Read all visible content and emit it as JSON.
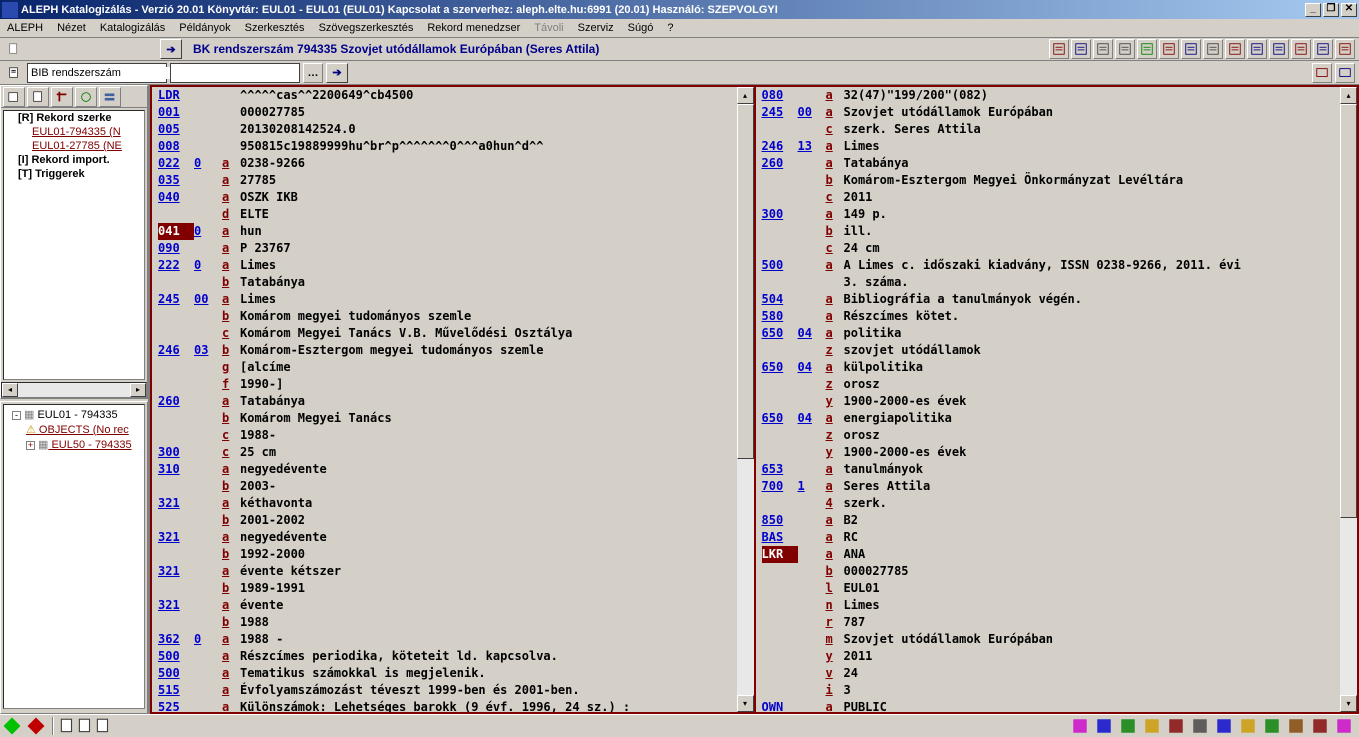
{
  "title": "ALEPH Katalogizálás - Verzió 20.01  Könyvtár: EUL01 - EUL01 (EUL01)  Kapcsolat a szerverhez:  aleph.elte.hu:6991 (20.01)  Használó:  SZEPVOLGYI",
  "menu": [
    "ALEPH",
    "Nézet",
    "Katalogizálás",
    "Példányok",
    "Szerkesztés",
    "Szövegszerkesztés",
    "Rekord menedzser",
    "Távoli",
    "Szerviz",
    "Súgó",
    "?"
  ],
  "menu_disabled": [
    7
  ],
  "record_label": "BK rendszerszám 794335 Szovjet utódállamok Európában (Seres Attila)",
  "combo_value": "BIB rendszerszám",
  "tree1": [
    {
      "label": "[R] Rekord szerke",
      "bold": true
    },
    {
      "label": "EUL01-794335 (N",
      "sub": true
    },
    {
      "label": "EUL01-27785 (NE",
      "sub": true
    },
    {
      "label": "[I] Rekord import.",
      "bold": true
    },
    {
      "label": "[T] Triggerek",
      "bold": true
    }
  ],
  "tree2": [
    {
      "exp": "-",
      "label": "EUL01 - 794335"
    },
    {
      "sub": true,
      "icon": "⚠",
      "label": "OBJECTS (No rec"
    },
    {
      "sub": true,
      "exp": "+",
      "label": "EUL50 - 794335"
    }
  ],
  "marc_left": [
    {
      "tag": "LDR",
      "ind": "",
      "sub": "",
      "val": "^^^^^cas^^2200649^cb4500"
    },
    {
      "tag": "001",
      "ind": "",
      "sub": "",
      "val": "000027785"
    },
    {
      "tag": "005",
      "ind": "",
      "sub": "",
      "val": "20130208142524.0"
    },
    {
      "tag": "008",
      "ind": "",
      "sub": "",
      "val": "950815c19889999hu^br^p^^^^^^^0^^^a0hun^d^^"
    },
    {
      "tag": "022",
      "ind": "0",
      "sub": "a",
      "val": "0238-9266"
    },
    {
      "tag": "035",
      "ind": "",
      "sub": "a",
      "val": "27785"
    },
    {
      "tag": "040",
      "ind": "",
      "sub": "a",
      "val": "OSZK IKB"
    },
    {
      "tag": "",
      "ind": "",
      "sub": "d",
      "val": "ELTE"
    },
    {
      "tag": "041",
      "ind": "0",
      "sub": "a",
      "val": "hun",
      "hl": true
    },
    {
      "tag": "090",
      "ind": "",
      "sub": "a",
      "val": "P 23767"
    },
    {
      "tag": "222",
      "ind": "0",
      "sub": "a",
      "val": "Limes"
    },
    {
      "tag": "",
      "ind": "",
      "sub": "b",
      "val": "Tatabánya"
    },
    {
      "tag": "245",
      "ind": "00",
      "sub": "a",
      "val": "Limes"
    },
    {
      "tag": "",
      "ind": "",
      "sub": "b",
      "val": "Komárom megyei tudományos szemle"
    },
    {
      "tag": "",
      "ind": "",
      "sub": "c",
      "val": "Komárom Megyei Tanács V.B. Művelődési Osztálya"
    },
    {
      "tag": "246",
      "ind": "03",
      "sub": "b",
      "val": "Komárom-Esztergom megyei tudományos szemle"
    },
    {
      "tag": "",
      "ind": "",
      "sub": "g",
      "val": "[alcíme"
    },
    {
      "tag": "",
      "ind": "",
      "sub": "f",
      "val": "1990-]"
    },
    {
      "tag": "260",
      "ind": "",
      "sub": "a",
      "val": "Tatabánya"
    },
    {
      "tag": "",
      "ind": "",
      "sub": "b",
      "val": "Komárom Megyei Tanács"
    },
    {
      "tag": "",
      "ind": "",
      "sub": "c",
      "val": "1988-"
    },
    {
      "tag": "300",
      "ind": "",
      "sub": "c",
      "val": "25 cm"
    },
    {
      "tag": "310",
      "ind": "",
      "sub": "a",
      "val": "negyedévente"
    },
    {
      "tag": "",
      "ind": "",
      "sub": "b",
      "val": "2003-"
    },
    {
      "tag": "321",
      "ind": "",
      "sub": "a",
      "val": "kéthavonta"
    },
    {
      "tag": "",
      "ind": "",
      "sub": "b",
      "val": "2001-2002"
    },
    {
      "tag": "321",
      "ind": "",
      "sub": "a",
      "val": "negyedévente"
    },
    {
      "tag": "",
      "ind": "",
      "sub": "b",
      "val": "1992-2000"
    },
    {
      "tag": "321",
      "ind": "",
      "sub": "a",
      "val": "évente kétszer"
    },
    {
      "tag": "",
      "ind": "",
      "sub": "b",
      "val": "1989-1991"
    },
    {
      "tag": "321",
      "ind": "",
      "sub": "a",
      "val": "évente"
    },
    {
      "tag": "",
      "ind": "",
      "sub": "b",
      "val": "1988"
    },
    {
      "tag": "362",
      "ind": "0",
      "sub": "a",
      "val": "1988 -"
    },
    {
      "tag": "500",
      "ind": "",
      "sub": "a",
      "val": "Részcímes periodika, köteteit ld. kapcsolva."
    },
    {
      "tag": "500",
      "ind": "",
      "sub": "a",
      "val": "Tematikus számokkal is megjelenik."
    },
    {
      "tag": "515",
      "ind": "",
      "sub": "a",
      "val": "Évfolyamszámozást téveszt 1999-ben és 2001-ben."
    },
    {
      "tag": "525",
      "ind": "",
      "sub": "a",
      "val": "Különszámok: Lehetséges barokk (9 évf. 1996, 24 sz.) :"
    }
  ],
  "marc_right": [
    {
      "tag": "080",
      "ind": "",
      "sub": "a",
      "val": "32(47)\"199/200\"(082)"
    },
    {
      "tag": "245",
      "ind": "00",
      "sub": "a",
      "val": "Szovjet utódállamok Európában"
    },
    {
      "tag": "",
      "ind": "",
      "sub": "c",
      "val": "szerk. Seres Attila"
    },
    {
      "tag": "246",
      "ind": "13",
      "sub": "a",
      "val": "Limes"
    },
    {
      "tag": "260",
      "ind": "",
      "sub": "a",
      "val": "Tatabánya"
    },
    {
      "tag": "",
      "ind": "",
      "sub": "b",
      "val": "Komárom-Esztergom Megyei Önkormányzat Levéltára"
    },
    {
      "tag": "",
      "ind": "",
      "sub": "c",
      "val": "2011"
    },
    {
      "tag": "300",
      "ind": "",
      "sub": "a",
      "val": "149 p."
    },
    {
      "tag": "",
      "ind": "",
      "sub": "b",
      "val": "ill."
    },
    {
      "tag": "",
      "ind": "",
      "sub": "c",
      "val": "24 cm"
    },
    {
      "tag": "500",
      "ind": "",
      "sub": "a",
      "val": "A Limes c. időszaki kiadvány, ISSN 0238-9266, 2011. évi"
    },
    {
      "tag": "",
      "ind": "",
      "sub": "",
      "val": "3. száma."
    },
    {
      "tag": "504",
      "ind": "",
      "sub": "a",
      "val": "Bibliográfia a tanulmányok végén."
    },
    {
      "tag": "580",
      "ind": "",
      "sub": "a",
      "val": "Részcímes kötet."
    },
    {
      "tag": "650",
      "ind": "04",
      "sub": "a",
      "val": "politika"
    },
    {
      "tag": "",
      "ind": "",
      "sub": "z",
      "val": "szovjet utódállamok"
    },
    {
      "tag": "650",
      "ind": "04",
      "sub": "a",
      "val": "külpolitika"
    },
    {
      "tag": "",
      "ind": "",
      "sub": "z",
      "val": "orosz"
    },
    {
      "tag": "",
      "ind": "",
      "sub": "y",
      "val": "1900-2000-es évek"
    },
    {
      "tag": "650",
      "ind": "04",
      "sub": "a",
      "val": "energiapolitika"
    },
    {
      "tag": "",
      "ind": "",
      "sub": "z",
      "val": "orosz"
    },
    {
      "tag": "",
      "ind": "",
      "sub": "y",
      "val": "1900-2000-es évek"
    },
    {
      "tag": "653",
      "ind": "",
      "sub": "a",
      "val": "tanulmányok"
    },
    {
      "tag": "700",
      "ind": "1",
      "sub": "a",
      "val": "Seres Attila"
    },
    {
      "tag": "",
      "ind": "",
      "sub": "4",
      "val": "szerk."
    },
    {
      "tag": "850",
      "ind": "",
      "sub": "a",
      "val": "B2"
    },
    {
      "tag": "BAS",
      "ind": "",
      "sub": "a",
      "val": "RC"
    },
    {
      "tag": "LKR",
      "ind": "",
      "sub": "a",
      "val": "ANA",
      "hl": true
    },
    {
      "tag": "",
      "ind": "",
      "sub": "b",
      "val": "000027785"
    },
    {
      "tag": "",
      "ind": "",
      "sub": "l",
      "val": "EUL01"
    },
    {
      "tag": "",
      "ind": "",
      "sub": "n",
      "val": "Limes"
    },
    {
      "tag": "",
      "ind": "",
      "sub": "r",
      "val": "787"
    },
    {
      "tag": "",
      "ind": "",
      "sub": "m",
      "val": "Szovjet utódállamok Európában"
    },
    {
      "tag": "",
      "ind": "",
      "sub": "y",
      "val": "2011"
    },
    {
      "tag": "",
      "ind": "",
      "sub": "v",
      "val": "24"
    },
    {
      "tag": "",
      "ind": "",
      "sub": "i",
      "val": "3"
    },
    {
      "tag": "OWN",
      "ind": "",
      "sub": "a",
      "val": "PUBLIC"
    }
  ]
}
